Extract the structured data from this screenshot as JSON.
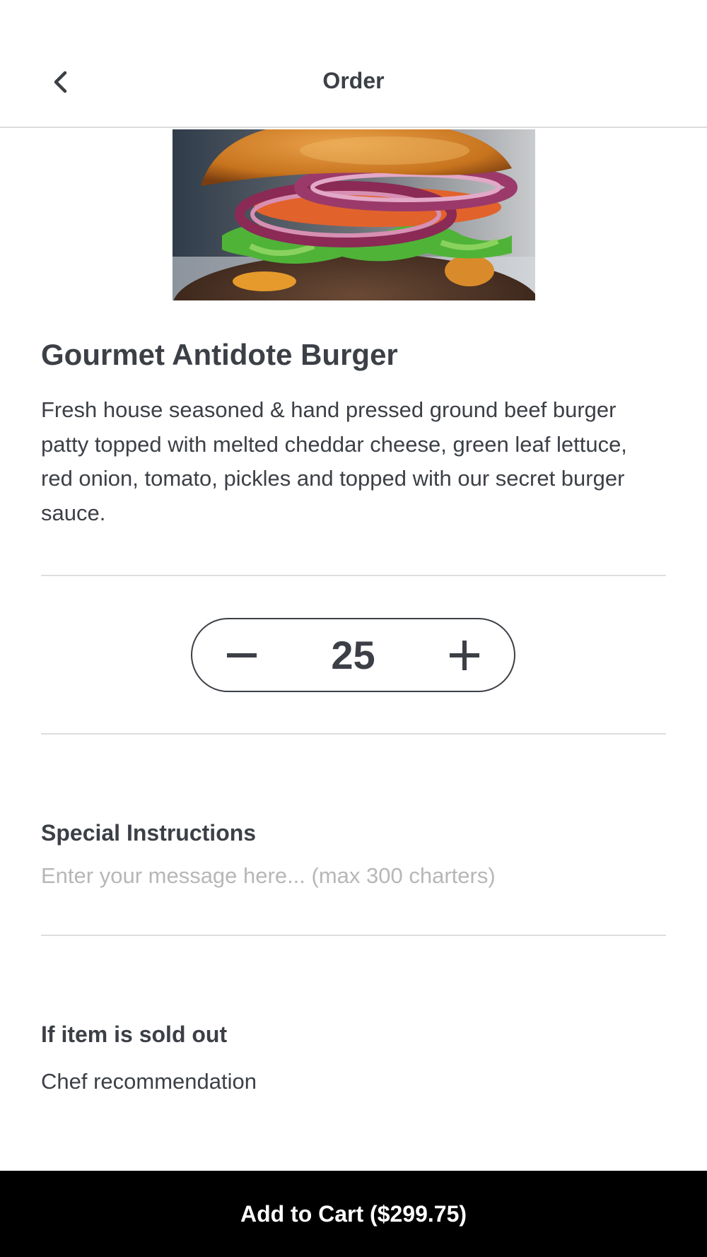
{
  "header": {
    "title": "Order",
    "back_icon": "chevron-left-icon"
  },
  "item": {
    "image": "burger-photo",
    "name": "Gourmet Antidote Burger",
    "description": "Fresh house seasoned & hand pressed ground beef burger patty topped with melted cheddar cheese, green leaf lettuce, red onion, tomato, pickles and topped with our secret burger sauce."
  },
  "quantity": {
    "value": "25",
    "decrement_icon": "minus-icon",
    "increment_icon": "plus-icon"
  },
  "special_instructions": {
    "label": "Special Instructions",
    "value": "",
    "placeholder": "Enter your message here... (max 300 charters)"
  },
  "sold_out": {
    "label": "If item is sold out",
    "value": "Chef recommendation"
  },
  "cart": {
    "label": "Add to Cart ($299.75)"
  },
  "colors": {
    "text": "#3c4046",
    "divider": "#dedede",
    "placeholder": "#b7b7b7",
    "cart_bar": "#000000",
    "cart_text": "#ffffff"
  }
}
